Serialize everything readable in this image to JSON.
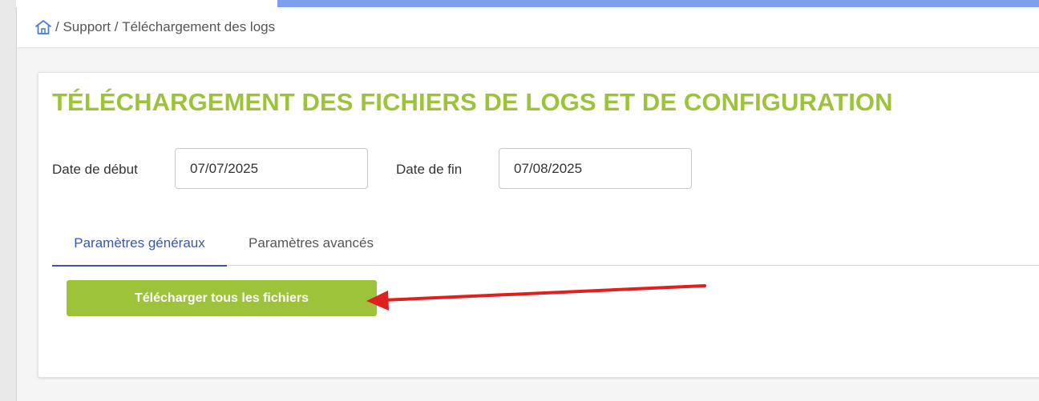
{
  "breadcrumb": {
    "home_icon": "home-icon",
    "separator": "/",
    "items": [
      "Support",
      "Téléchargement des logs"
    ]
  },
  "page": {
    "title": "TÉLÉCHARGEMENT DES FICHIERS DE LOGS ET DE CONFIGURATION"
  },
  "form": {
    "start_date_label": "Date de début",
    "start_date_value": "07/07/2025",
    "end_date_label": "Date de fin",
    "end_date_value": "07/08/2025"
  },
  "tabs": [
    {
      "label": "Paramètres généraux",
      "active": true
    },
    {
      "label": "Paramètres avancés",
      "active": false
    }
  ],
  "actions": {
    "download_all_label": "Télécharger tous les fichiers"
  },
  "colors": {
    "accent_green": "#9dc33b",
    "tab_active_blue": "#3a56b0",
    "top_bar_blue": "#7ea0ec",
    "annotation_arrow_red": "#e02020"
  }
}
